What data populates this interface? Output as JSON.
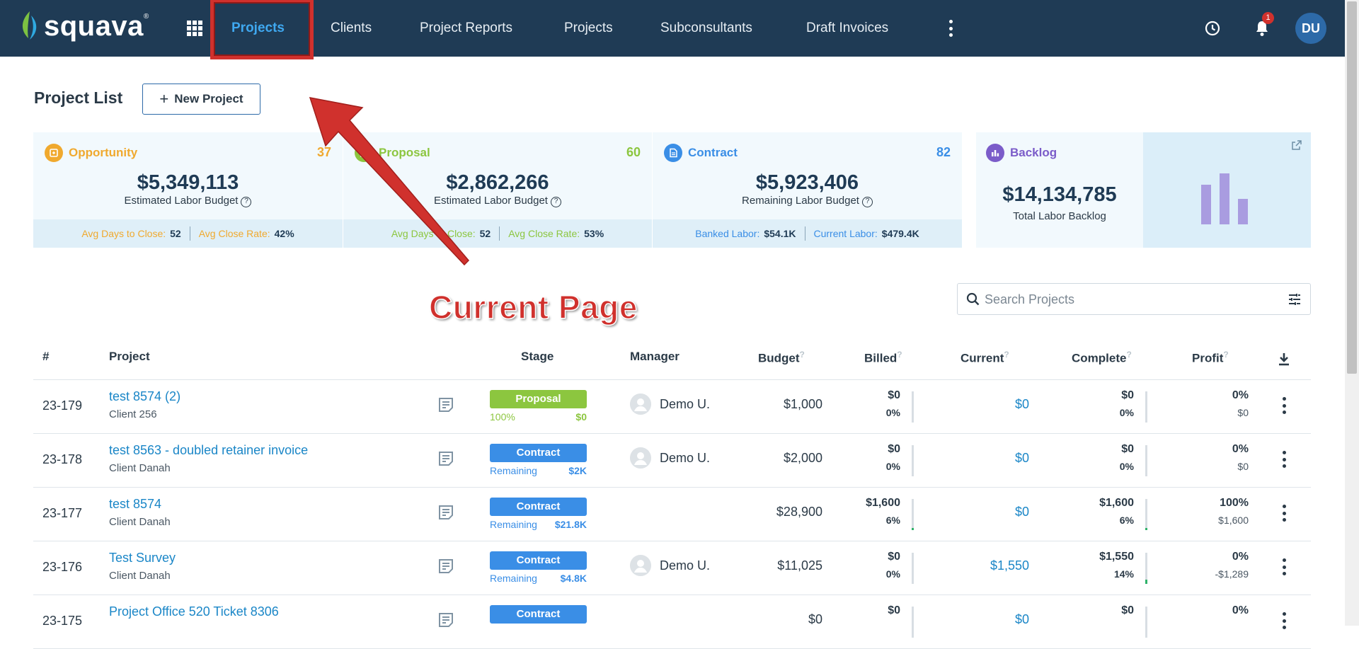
{
  "app": {
    "name": "squava",
    "reg": "®"
  },
  "nav": {
    "items": [
      "Projects",
      "Clients",
      "Project Reports",
      "Projects",
      "Subconsultants",
      "Draft Invoices"
    ],
    "notification_count": "1",
    "avatar_initials": "DU"
  },
  "page": {
    "title": "Project List",
    "new_project_label": "New Project",
    "new_project_icon": "+"
  },
  "summary": {
    "opportunity": {
      "label": "Opportunity",
      "count": "37",
      "amount": "$5,349,113",
      "sub": "Estimated Labor Budget",
      "f1_label": "Avg Days to Close:",
      "f1_value": "52",
      "f2_label": "Avg Close Rate:",
      "f2_value": "42%",
      "color": "#f0a92e"
    },
    "proposal": {
      "label": "Proposal",
      "count": "60",
      "amount": "$2,862,266",
      "sub": "Estimated Labor Budget",
      "f1_label": "Avg Days to Close:",
      "f1_value": "52",
      "f2_label": "Avg Close Rate:",
      "f2_value": "53%",
      "color": "#8cc63f"
    },
    "contract": {
      "label": "Contract",
      "count": "82",
      "amount": "$5,923,406",
      "sub": "Remaining Labor Budget",
      "f1_label": "Banked Labor:",
      "f1_value": "$54.1K",
      "f2_label": "Current Labor:",
      "f2_value": "$479.4K",
      "color": "#3a8ee6"
    },
    "backlog": {
      "label": "Backlog",
      "amount": "$14,134,785",
      "sub": "Total Labor Backlog",
      "color": "#7b5cc9"
    }
  },
  "search": {
    "placeholder": "Search Projects"
  },
  "annotation": {
    "text": "Current Page",
    "color": "#d0312d"
  },
  "table": {
    "headers": {
      "num": "#",
      "project": "Project",
      "stage": "Stage",
      "manager": "Manager",
      "budget": "Budget",
      "billed": "Billed",
      "current": "Current",
      "complete": "Complete",
      "profit": "Profit",
      "hint": "?"
    },
    "rows": [
      {
        "num": "23-179",
        "name": "test 8574 (2)",
        "client": "Client 256",
        "stage": "Proposal",
        "stage_color": "#8cc63f",
        "stage_left": "100%",
        "stage_right": "$0",
        "manager": "Demo U.",
        "budget": "$1,000",
        "billed": "$0",
        "billed_pct": "0%",
        "billed_fill": 0,
        "current": "$0",
        "complete": "$0",
        "complete_pct": "0%",
        "complete_fill": 0,
        "profit_pct": "0%",
        "profit": "$0"
      },
      {
        "num": "23-178",
        "name": "test 8563 - doubled retainer invoice",
        "client": "Client Danah",
        "stage": "Contract",
        "stage_color": "#3a8ee6",
        "stage_left": "Remaining",
        "stage_right": "$2K",
        "manager": "Demo U.",
        "budget": "$2,000",
        "billed": "$0",
        "billed_pct": "0%",
        "billed_fill": 0,
        "current": "$0",
        "complete": "$0",
        "complete_pct": "0%",
        "complete_fill": 0,
        "profit_pct": "0%",
        "profit": "$0"
      },
      {
        "num": "23-177",
        "name": "test 8574",
        "client": "Client Danah",
        "stage": "Contract",
        "stage_color": "#3a8ee6",
        "stage_left": "Remaining",
        "stage_right": "$21.8K",
        "manager": "",
        "budget": "$28,900",
        "billed": "$1,600",
        "billed_pct": "6%",
        "billed_fill": 6,
        "current": "$0",
        "complete": "$1,600",
        "complete_pct": "6%",
        "complete_fill": 6,
        "profit_pct": "100%",
        "profit": "$1,600"
      },
      {
        "num": "23-176",
        "name": "Test Survey",
        "client": "Client Danah",
        "stage": "Contract",
        "stage_color": "#3a8ee6",
        "stage_left": "Remaining",
        "stage_right": "$4.8K",
        "manager": "Demo U.",
        "budget": "$11,025",
        "billed": "$0",
        "billed_pct": "0%",
        "billed_fill": 0,
        "current": "$1,550",
        "complete": "$1,550",
        "complete_pct": "14%",
        "complete_fill": 14,
        "profit_pct": "0%",
        "profit": "-$1,289"
      },
      {
        "num": "23-175",
        "name": "Project Office 520 Ticket 8306",
        "client": "",
        "stage": "Contract",
        "stage_color": "#3a8ee6",
        "stage_left": "",
        "stage_right": "",
        "manager": "",
        "budget": "$0",
        "billed": "$0",
        "billed_pct": "",
        "billed_fill": 0,
        "current": "$0",
        "complete": "$0",
        "complete_pct": "",
        "complete_fill": 0,
        "profit_pct": "0%",
        "profit": ""
      }
    ]
  },
  "icons": {
    "grid": "apps-grid-icon",
    "more": "more-vert-icon",
    "clock": "clock-icon",
    "bell": "bell-icon",
    "search": "search-icon",
    "filter": "tune-icon",
    "download": "download-icon",
    "note": "note-icon",
    "expand": "open-external-icon"
  }
}
